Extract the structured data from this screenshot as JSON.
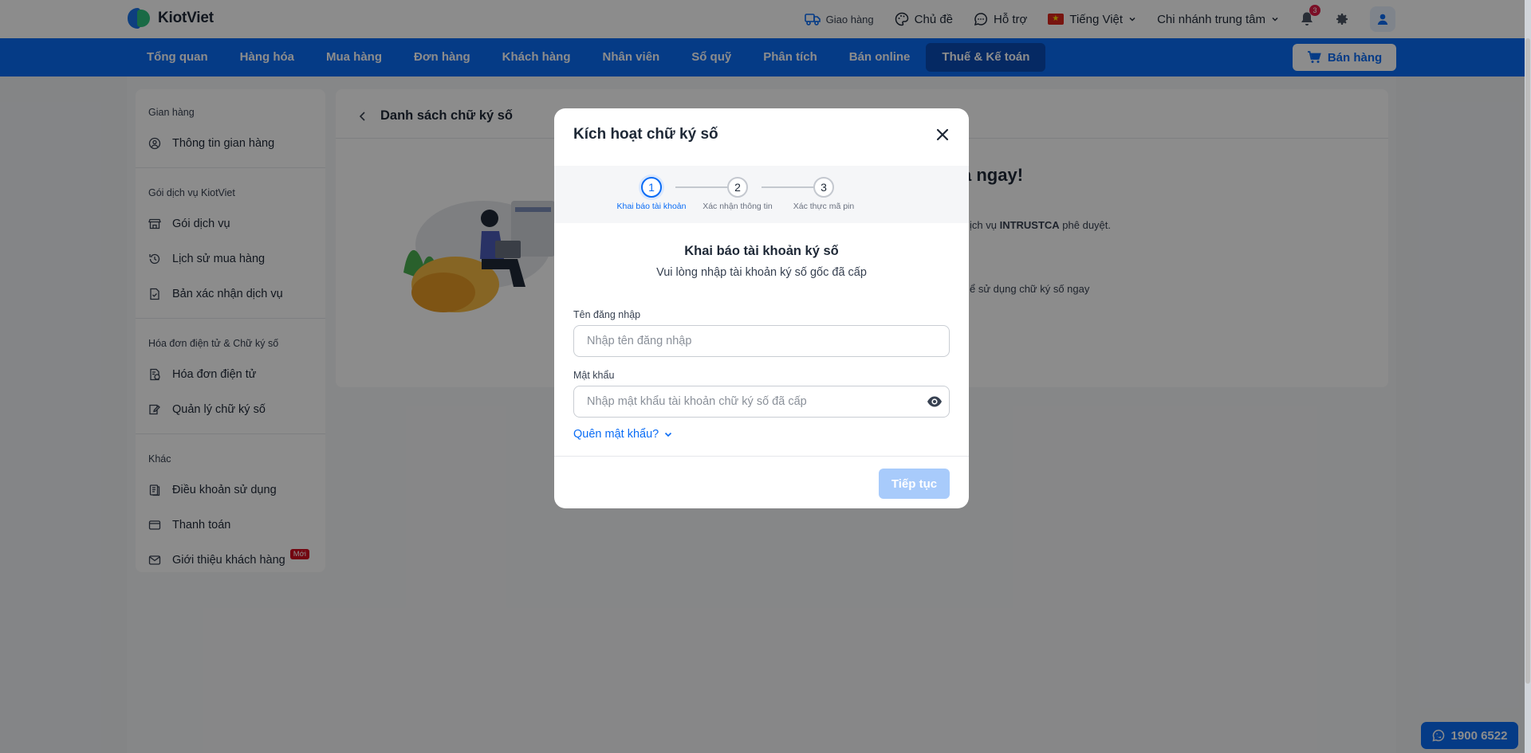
{
  "brand": {
    "name": "KiotViet"
  },
  "topbar": {
    "delivery": "Giao hàng",
    "theme": "Chủ đề",
    "support": "Hỗ trợ",
    "language": "Tiếng Việt",
    "branch": "Chi nhánh trung tâm",
    "notification_count": "3"
  },
  "nav": {
    "items": [
      "Tổng quan",
      "Hàng hóa",
      "Mua hàng",
      "Đơn hàng",
      "Khách hàng",
      "Nhân viên",
      "Sổ quỹ",
      "Phân tích",
      "Bán online",
      "Thuế & Kế toán"
    ],
    "active_index": 9,
    "sell_label": "Bán hàng"
  },
  "sidebar": {
    "sections": [
      {
        "header": "Gian hàng",
        "items": [
          {
            "label": "Thông tin gian hàng",
            "icon": "user-circle-icon"
          }
        ]
      },
      {
        "header": "Gói dịch vụ KiotViet",
        "items": [
          {
            "label": "Gói dịch vụ",
            "icon": "store-icon"
          },
          {
            "label": "Lịch sử mua hàng",
            "icon": "history-icon"
          },
          {
            "label": "Bản xác nhận dịch vụ",
            "icon": "document-check-icon"
          }
        ]
      },
      {
        "header": "Hóa đơn điện tử & Chữ ký số",
        "items": [
          {
            "label": "Hóa đơn điện tử",
            "icon": "invoice-icon"
          },
          {
            "label": "Quản lý chữ ký số",
            "icon": "signature-icon"
          }
        ]
      },
      {
        "header": "Khác",
        "items": [
          {
            "label": "Điều khoản sử dụng",
            "icon": "terms-icon"
          },
          {
            "label": "Thanh toán",
            "icon": "wallet-icon"
          },
          {
            "label": "Giới thiệu khách hàng",
            "icon": "mail-icon",
            "tag": "Mới"
          }
        ]
      }
    ]
  },
  "main": {
    "title": "Danh sách chữ ký số",
    "hero_fragment": "a ngay!",
    "line1_prefix": "ịch vụ ",
    "line1_bold": "INTRUSTCA",
    "line1_suffix": " phê duyệt.",
    "line2": "ể sử dụng chữ ký số ngay"
  },
  "modal": {
    "title": "Kích hoạt chữ ký số",
    "steps": [
      {
        "num": "1",
        "label": "Khai báo tài khoản"
      },
      {
        "num": "2",
        "label": "Xác nhận thông tin"
      },
      {
        "num": "3",
        "label": "Xác thực mã pin"
      }
    ],
    "active_step": 0,
    "heading": "Khai báo tài khoản ký số",
    "subheading": "Vui lòng nhập tài khoản ký số gốc đã cấp",
    "username_label": "Tên đăng nhập",
    "username_placeholder": "Nhập tên đăng nhập",
    "username_value": "",
    "password_label": "Mật khẩu",
    "password_placeholder": "Nhập mật khẩu tài khoản chữ ký số đã cấp",
    "password_value": "",
    "forgot": "Quên mật khẩu?",
    "continue": "Tiếp tục"
  },
  "hotline": "1900 6522",
  "colors": {
    "primary": "#0a6cf5",
    "nav_active": "#0a4bb5",
    "badge": "#e11d48",
    "disabled_button": "#a8cbfb"
  }
}
